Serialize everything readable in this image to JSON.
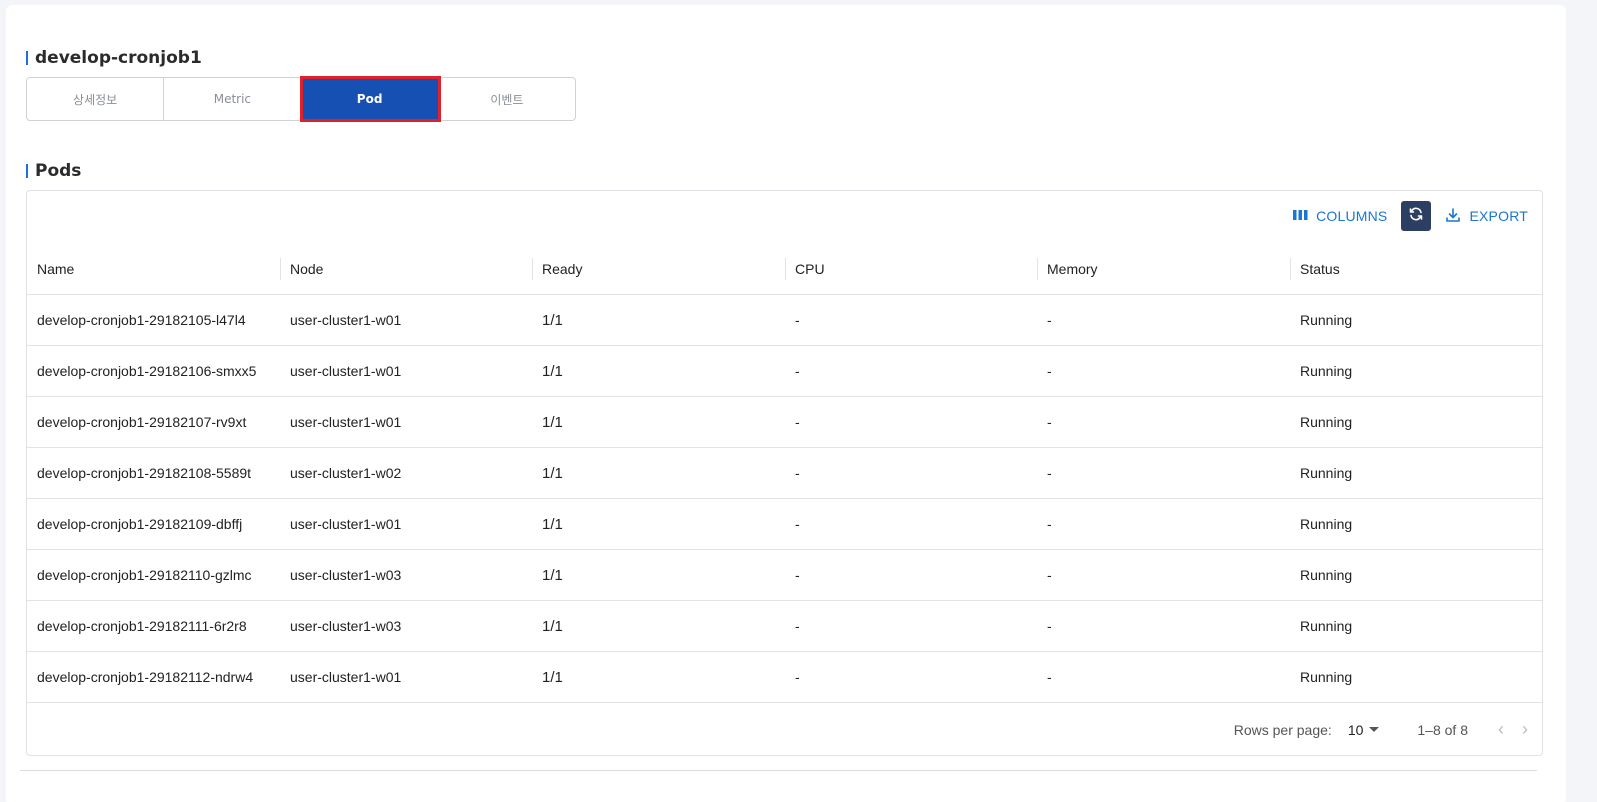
{
  "header": {
    "title": "develop-cronjob1"
  },
  "tabs": [
    {
      "label": "상세정보"
    },
    {
      "label": "Metric"
    },
    {
      "label": "Pod"
    },
    {
      "label": "이벤트"
    }
  ],
  "pods_section": {
    "title": "Pods"
  },
  "toolbar": {
    "columns_label": "COLUMNS",
    "export_label": "EXPORT"
  },
  "table": {
    "columns": [
      "Name",
      "Node",
      "Ready",
      "CPU",
      "Memory",
      "Status"
    ],
    "rows": [
      [
        "develop-cronjob1-29182105-l47l4",
        "user-cluster1-w01",
        "1/1",
        "-",
        "-",
        "Running"
      ],
      [
        "develop-cronjob1-29182106-smxx5",
        "user-cluster1-w01",
        "1/1",
        "-",
        "-",
        "Running"
      ],
      [
        "develop-cronjob1-29182107-rv9xt",
        "user-cluster1-w01",
        "1/1",
        "-",
        "-",
        "Running"
      ],
      [
        "develop-cronjob1-29182108-5589t",
        "user-cluster1-w02",
        "1/1",
        "-",
        "-",
        "Running"
      ],
      [
        "develop-cronjob1-29182109-dbffj",
        "user-cluster1-w01",
        "1/1",
        "-",
        "-",
        "Running"
      ],
      [
        "develop-cronjob1-29182110-gzlmc",
        "user-cluster1-w03",
        "1/1",
        "-",
        "-",
        "Running"
      ],
      [
        "develop-cronjob1-29182111-6r2r8",
        "user-cluster1-w03",
        "1/1",
        "-",
        "-",
        "Running"
      ],
      [
        "develop-cronjob1-29182112-ndrw4",
        "user-cluster1-w01",
        "1/1",
        "-",
        "-",
        "Running"
      ]
    ]
  },
  "pagination": {
    "rows_per_page_label": "Rows per page:",
    "rows_per_page_value": "10",
    "range_label": "1–8 of 8"
  },
  "colors": {
    "accent": "#1650b2",
    "link": "#1976d2",
    "highlight": "#e0202a",
    "refresh_bg": "#2d3e63"
  }
}
